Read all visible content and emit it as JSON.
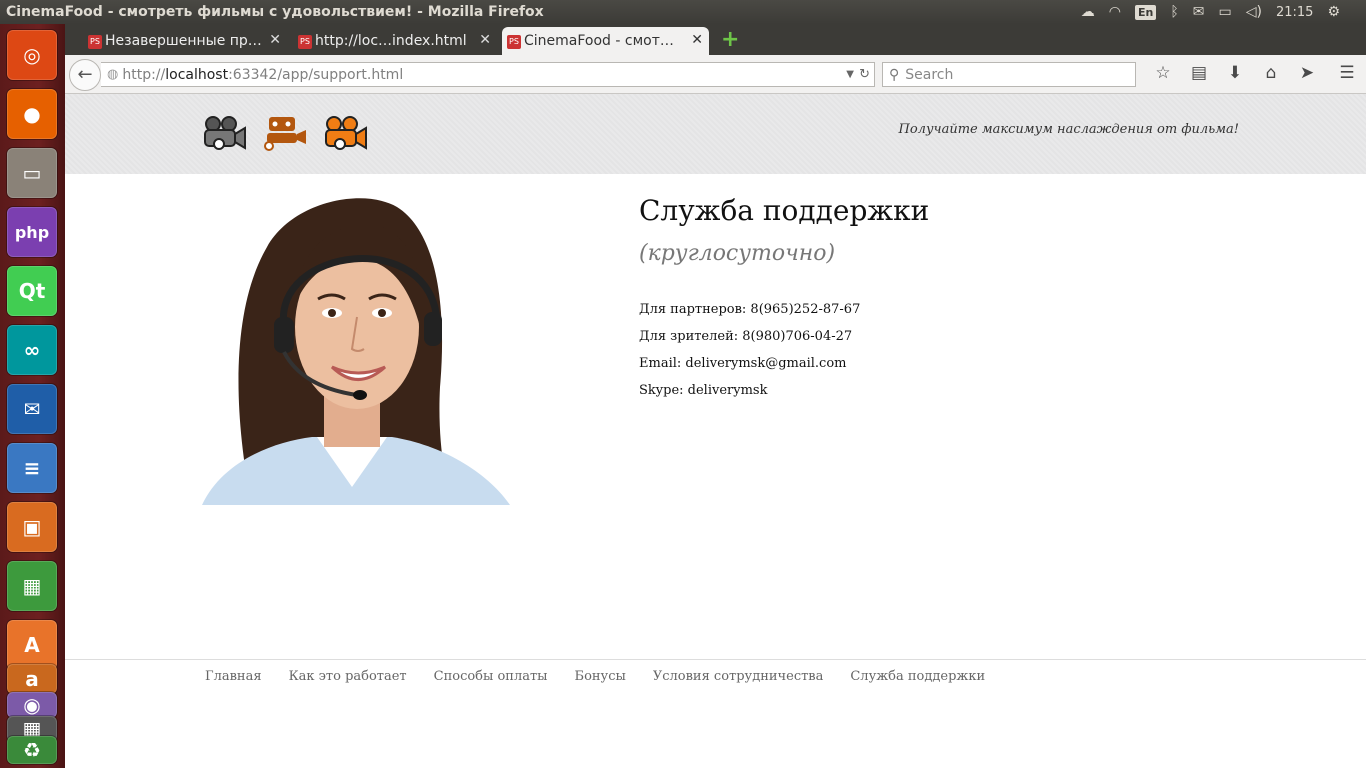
{
  "system": {
    "window_title": "CinemaFood - смотреть фильмы с удовольствием! - Mozilla Firefox",
    "keyboard_layout": "En",
    "clock": "21:15"
  },
  "launcher": {
    "apps": [
      {
        "name": "ubuntu-dash-icon",
        "glyph": "◎",
        "color": "#dd4814"
      },
      {
        "name": "firefox-icon",
        "glyph": "●",
        "color": "#e66000"
      },
      {
        "name": "files-icon",
        "glyph": "▭",
        "color": "#8a8278"
      },
      {
        "name": "phpstorm-icon",
        "glyph": "php",
        "color": "#7b3fb0"
      },
      {
        "name": "qt-creator-icon",
        "glyph": "Qt",
        "color": "#41cd52"
      },
      {
        "name": "arduino-icon",
        "glyph": "∞",
        "color": "#00979d"
      },
      {
        "name": "thunderbird-icon",
        "glyph": "✉",
        "color": "#1f5ea8"
      },
      {
        "name": "writer-icon",
        "glyph": "≡",
        "color": "#3a78c2"
      },
      {
        "name": "impress-icon",
        "glyph": "▣",
        "color": "#d96b20"
      },
      {
        "name": "calc-icon",
        "glyph": "▦",
        "color": "#3d9a3d"
      },
      {
        "name": "software-center-icon",
        "glyph": "A",
        "color": "#e8732a"
      }
    ]
  },
  "tabs": [
    {
      "label": "Незавершенные пр…"
    },
    {
      "label": "http://loc…index.html"
    },
    {
      "label": "CinemaFood - смот…"
    }
  ],
  "navbar": {
    "url_prefix": "http://",
    "url_host": "localhost",
    "url_rest": ":63342/app/support.html",
    "search_placeholder": "Search"
  },
  "site": {
    "tagline": "Получайте максимум наслаждения от фильма!",
    "title": "Служба поддержки",
    "subtitle": "(круглосуточно)",
    "contacts": [
      "Для партнеров: 8(965)252-87-67",
      "Для зрителей: 8(980)706-04-27",
      "Email: deliverymsk@gmail.com",
      "Skype: deliverymsk"
    ],
    "footer_links": [
      "Главная",
      "Как это работает",
      "Способы оплаты",
      "Бонусы",
      "Условия сотрудничества",
      "Служба поддержки"
    ]
  }
}
